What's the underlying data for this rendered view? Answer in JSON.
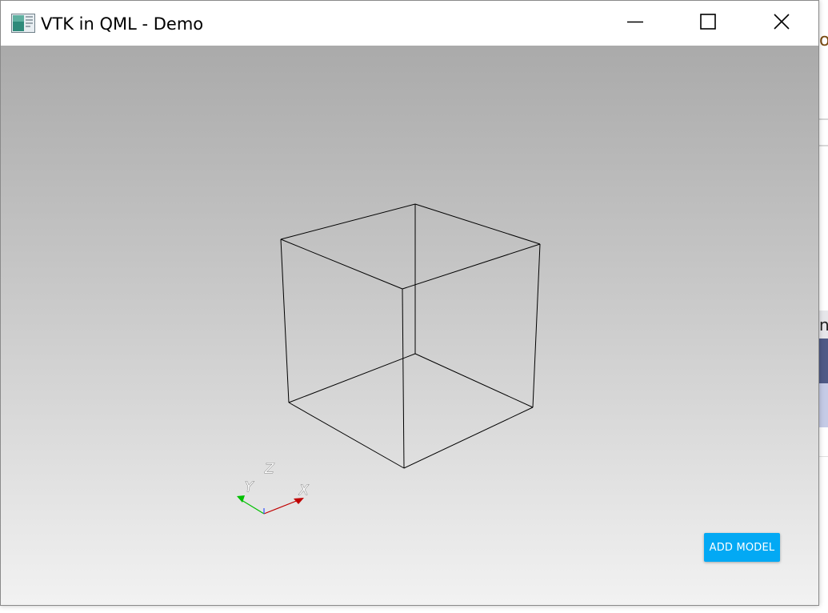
{
  "window": {
    "title": "VTK in QML - Demo",
    "icons": {
      "app": "app-window-icon",
      "minimize": "minimize-icon",
      "maximize": "maximize-icon",
      "close": "close-icon"
    }
  },
  "viewport": {
    "background_top": "#aaaaaa",
    "background_bottom": "#f2f2f2",
    "orientation_axes": {
      "x_label": "X",
      "y_label": "Y",
      "z_label": "Z",
      "x_color": "#c00000",
      "y_color": "#00c000",
      "z_color": "#3050ff"
    }
  },
  "actions": {
    "add_model_label": "ADD MODEL",
    "accent_color": "#03a9f4"
  },
  "background_desktop": {
    "glyph_top": "o",
    "glyph_mid": "n"
  }
}
